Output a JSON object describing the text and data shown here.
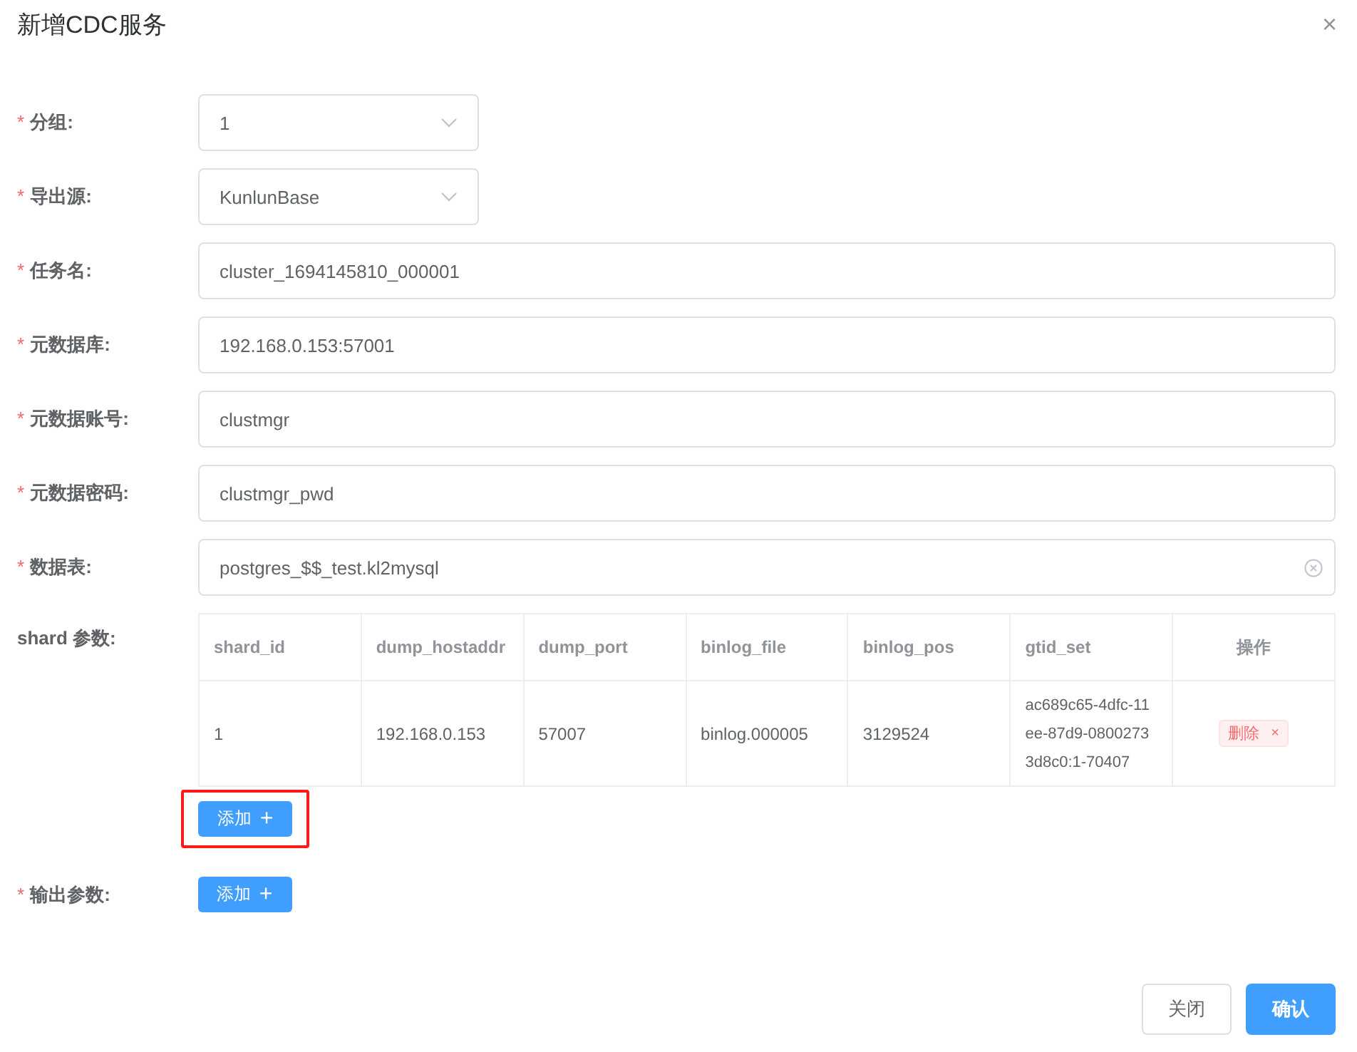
{
  "dialog": {
    "title": "新增CDC服务",
    "close": "×"
  },
  "fields": [
    {
      "required_mark": "*",
      "label": "分组:",
      "kind": "select",
      "value": "1"
    },
    {
      "required_mark": "*",
      "label": "导出源:",
      "kind": "select",
      "value": "KunlunBase"
    },
    {
      "required_mark": "*",
      "label": "任务名:",
      "kind": "input",
      "value": "cluster_1694145810_000001"
    },
    {
      "required_mark": "*",
      "label": "元数据库:",
      "kind": "input",
      "value": "192.168.0.153:57001"
    },
    {
      "required_mark": "*",
      "label": "元数据账号:",
      "kind": "input",
      "value": "clustmgr"
    },
    {
      "required_mark": "*",
      "label": "元数据密码:",
      "kind": "input",
      "value": "clustmgr_pwd"
    },
    {
      "required_mark": "*",
      "label": "数据表:",
      "kind": "clearable",
      "value": "postgres_$$_test.kl2mysql"
    }
  ],
  "shard_params": {
    "label": "shard 参数:",
    "table": {
      "columns": [
        "shard_id",
        "dump_hostaddr",
        "dump_port",
        "binlog_file",
        "binlog_pos",
        "gtid_set",
        "操作"
      ],
      "rows": [
        {
          "cells": [
            "1",
            "192.168.0.153",
            "57007",
            "binlog.000005",
            "3129524",
            "ac689c65-4dfc-11ee-87d9-08002733d8c0:1-70407"
          ],
          "action": "删除",
          "action_close": "×"
        }
      ]
    },
    "add_button": {
      "label": "添加",
      "icon": "+",
      "highlighted": true
    }
  },
  "output_params": {
    "required_mark": "*",
    "label": "输出参数:",
    "add_button": {
      "label": "添加",
      "icon": "+",
      "highlighted": false
    }
  },
  "footer": {
    "buttons": [
      {
        "label": "关闭",
        "primary": false
      },
      {
        "label": "确认",
        "primary": true
      }
    ]
  }
}
